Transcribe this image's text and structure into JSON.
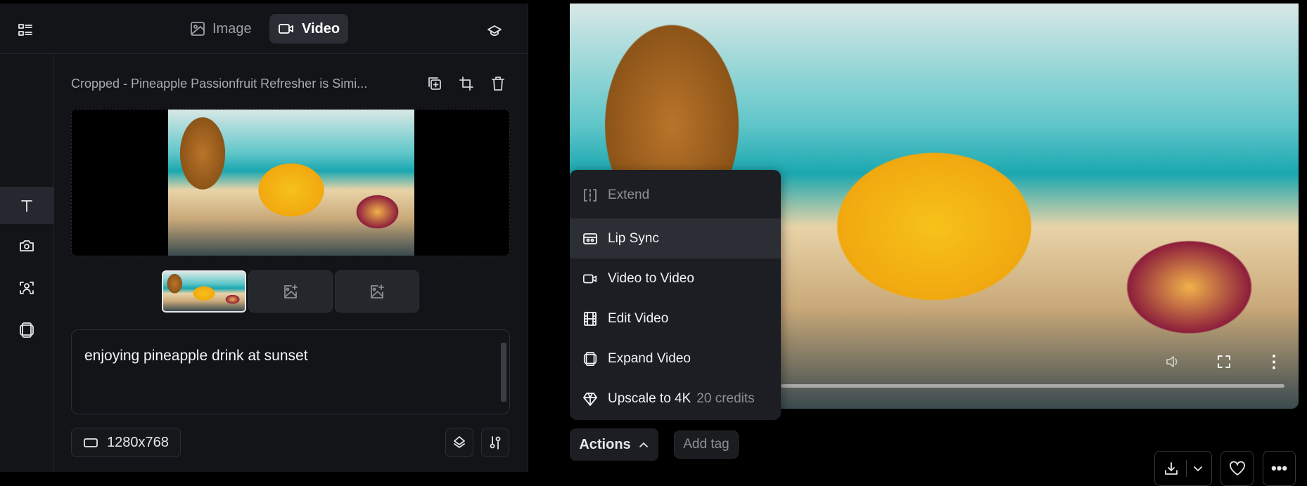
{
  "header": {
    "tabs": [
      {
        "label": "Image",
        "icon": "image-icon",
        "active": false
      },
      {
        "label": "Video",
        "icon": "video-camera-icon",
        "active": true
      }
    ]
  },
  "rail": {
    "items": [
      {
        "icon": "text-icon",
        "active": true
      },
      {
        "icon": "camera-icon"
      },
      {
        "icon": "face-scan-icon"
      },
      {
        "icon": "expand-frame-icon"
      }
    ]
  },
  "asset": {
    "title": "Cropped - Pineapple Passionfruit Refresher is Simi..."
  },
  "prompt": {
    "value": "enjoying pineapple drink at sunset"
  },
  "settings": {
    "aspect": "1280x768"
  },
  "actions_menu": {
    "items": [
      {
        "label": "Extend",
        "icon": "extend-icon",
        "disabled": true
      },
      {
        "label": "Lip Sync",
        "icon": "lip-sync-icon",
        "highlighted": true
      },
      {
        "label": "Video to Video",
        "icon": "video-camera-icon"
      },
      {
        "label": "Edit Video",
        "icon": "film-icon"
      },
      {
        "label": "Expand Video",
        "icon": "expand-frame-icon"
      },
      {
        "label": "Upscale to 4K",
        "icon": "diamond-icon",
        "note": "20 credits"
      }
    ]
  },
  "footer": {
    "actions_label": "Actions",
    "add_tag_label": "Add tag"
  },
  "colors": {
    "panel": "#121418",
    "menu": "#1c1e23",
    "highlight": "#2b2e34",
    "muted": "#8b8f98"
  }
}
